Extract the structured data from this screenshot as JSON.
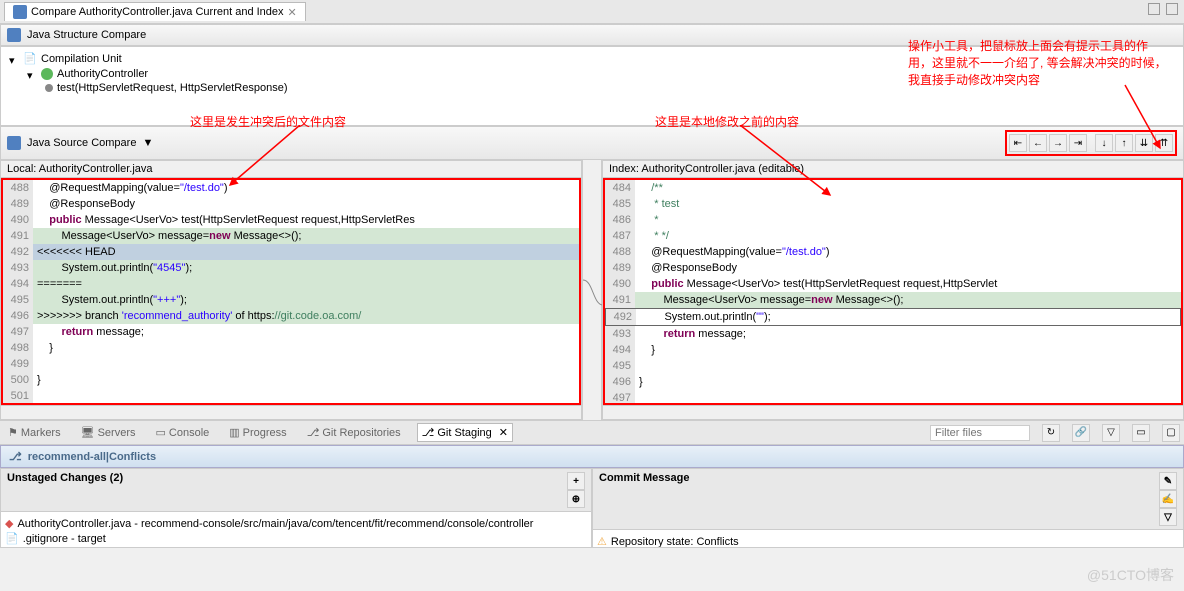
{
  "window": {
    "tab_title": "Compare AuthorityController.java Current and Index"
  },
  "structure": {
    "title": "Java Structure Compare",
    "root": "Compilation Unit",
    "class": "AuthorityController",
    "method": "test(HttpServletRequest, HttpServletResponse)"
  },
  "sourceCompare": {
    "title": "Java Source Compare",
    "leftTitle": "Local: AuthorityController.java",
    "rightTitle": "Index: AuthorityController.java (editable)"
  },
  "leftCode": [
    {
      "n": "488",
      "pre": "    ",
      "html": "@RequestMapping(value=<span class='str'>\"/test.do\"</span>)"
    },
    {
      "n": "489",
      "pre": "    ",
      "html": "@ResponseBody"
    },
    {
      "n": "490",
      "pre": "    ",
      "html": "<span class='kw'>public</span> Message&lt;UserVo&gt; test(HttpServletRequest request,HttpServletRes"
    },
    {
      "n": "491",
      "pre": "        ",
      "html": "Message&lt;UserVo&gt; message=<span class='kw'>new</span> Message&lt;&gt;();",
      "cls": "conflict-bg"
    },
    {
      "n": "492",
      "pre": "",
      "html": "&lt;&lt;&lt;&lt;&lt;&lt;&lt; HEAD",
      "cls": "conflict-sel"
    },
    {
      "n": "493",
      "pre": "        ",
      "html": "System.out.println(<span class='str'>\"4545\"</span>);",
      "cls": "conflict-bg"
    },
    {
      "n": "494",
      "pre": "",
      "html": "=======",
      "cls": "conflict-bg"
    },
    {
      "n": "495",
      "pre": "        ",
      "html": "System.out.println(<span class='str'>\"+++\"</span>);",
      "cls": "conflict-bg"
    },
    {
      "n": "496",
      "pre": "",
      "html": "&gt;&gt;&gt;&gt;&gt;&gt;&gt; branch <span class='str'>'recommend_authority'</span> of https:<span class='cmt'>//git.code.oa.com/</span>",
      "cls": "conflict-bg"
    },
    {
      "n": "497",
      "pre": "        ",
      "html": "<span class='kw'>return</span> message;"
    },
    {
      "n": "498",
      "pre": "    ",
      "html": "}"
    },
    {
      "n": "499",
      "pre": "",
      "html": ""
    },
    {
      "n": "500",
      "pre": "",
      "html": "}"
    },
    {
      "n": "501",
      "pre": "",
      "html": ""
    }
  ],
  "rightCode": [
    {
      "n": "484",
      "pre": "    ",
      "html": "<span class='cmt'>/**</span>"
    },
    {
      "n": "485",
      "pre": "    ",
      "html": "<span class='cmt'> * test</span>"
    },
    {
      "n": "486",
      "pre": "    ",
      "html": "<span class='cmt'> *</span>"
    },
    {
      "n": "487",
      "pre": "    ",
      "html": "<span class='cmt'> * */</span>"
    },
    {
      "n": "488",
      "pre": "    ",
      "html": "@RequestMapping(value=<span class='str'>\"/test.do\"</span>)"
    },
    {
      "n": "489",
      "pre": "    ",
      "html": "@ResponseBody"
    },
    {
      "n": "490",
      "pre": "    ",
      "html": "<span class='kw'>public</span> Message&lt;UserVo&gt; test(HttpServletRequest request,HttpServlet"
    },
    {
      "n": "491",
      "pre": "        ",
      "html": "Message&lt;UserVo&gt; message=<span class='kw'>new</span> Message&lt;&gt;();",
      "cls": "diff-line"
    },
    {
      "n": "492",
      "pre": "        ",
      "html": "System.out.println(<span class='str'>\"\"</span>);",
      "cls": "sel-line"
    },
    {
      "n": "493",
      "pre": "        ",
      "html": "<span class='kw'>return</span> message;"
    },
    {
      "n": "494",
      "pre": "    ",
      "html": "}"
    },
    {
      "n": "495",
      "pre": "",
      "html": ""
    },
    {
      "n": "496",
      "pre": "",
      "html": "}"
    },
    {
      "n": "497",
      "pre": "",
      "html": ""
    }
  ],
  "bottomTabs": {
    "markers": "Markers",
    "servers": "Servers",
    "console": "Console",
    "progress": "Progress",
    "gitRepos": "Git Repositories",
    "gitStaging": "Git Staging",
    "filterPlaceholder": "Filter files"
  },
  "staging": {
    "branchLabel": "recommend-all|Conflicts",
    "unstagedTitle": "Unstaged Changes (2)",
    "file1": "AuthorityController.java - recommend-console/src/main/java/com/tencent/fit/recommend/console/controller",
    "file2": ".gitignore - target",
    "commitTitle": "Commit Message",
    "repoState": "Repository state: Conflicts"
  },
  "annotations": {
    "left": "这里是发生冲突后的文件内容",
    "right": "这里是本地修改之前的内容",
    "toolbar": "操作小工具，把鼠标放上面会有提示工具的作用，这里就不一一介绍了, 等会解决冲突的时候，我直接手动修改冲突内容"
  },
  "watermark": "@51CTO博客"
}
